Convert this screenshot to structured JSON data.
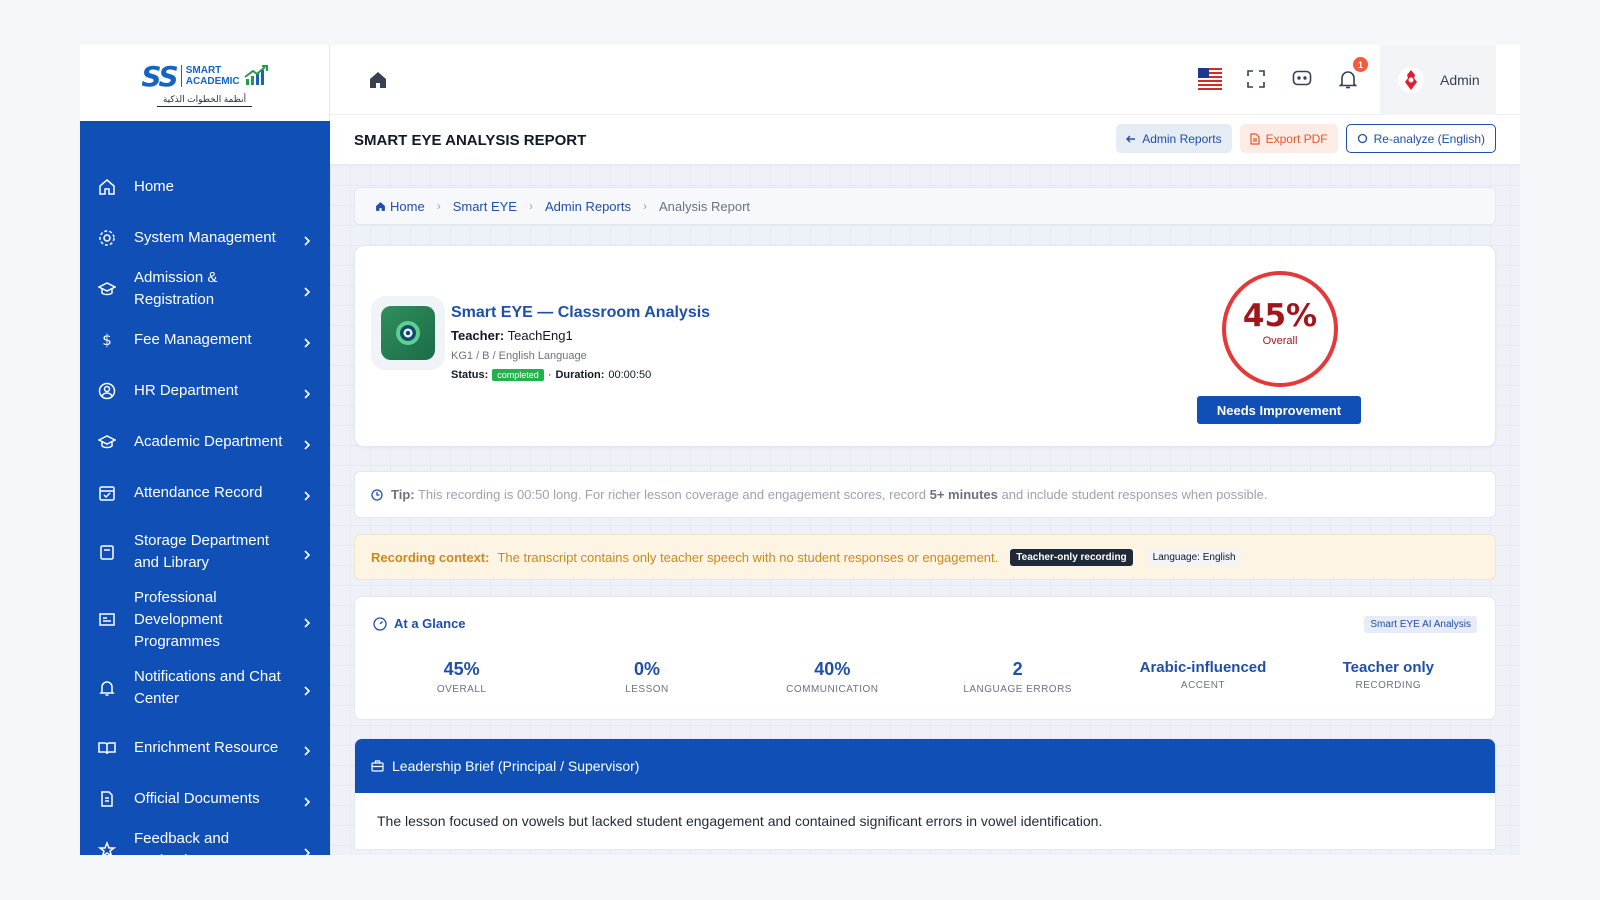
{
  "logo": {
    "mark": "SS",
    "line1": "SMART",
    "line2": "ACADEMIC",
    "arabic": "أنظمة الخطوات الذكية"
  },
  "sidebar": {
    "items": [
      {
        "label": "Home",
        "icon": "home-icon",
        "chevron": false
      },
      {
        "label": "System Management",
        "icon": "gear-icon",
        "chevron": true
      },
      {
        "label": "Admission & Registration",
        "icon": "graduation-cap-icon",
        "chevron": true
      },
      {
        "label": "Fee Management",
        "icon": "dollar-icon",
        "chevron": true
      },
      {
        "label": "HR Department",
        "icon": "user-circle-icon",
        "chevron": true
      },
      {
        "label": "Academic Department",
        "icon": "graduation-cap-icon",
        "chevron": true
      },
      {
        "label": "Attendance Record",
        "icon": "calendar-check-icon",
        "chevron": true
      },
      {
        "label": "Storage Department and Library",
        "icon": "archive-icon",
        "chevron": true
      },
      {
        "label": "Professional Development Programmes",
        "icon": "presentation-icon",
        "chevron": true
      },
      {
        "label": "Notifications and Chat Center",
        "icon": "bell-icon",
        "chevron": true
      },
      {
        "label": "Enrichment Resource",
        "icon": "book-open-icon",
        "chevron": true
      },
      {
        "label": "Official Documents",
        "icon": "document-icon",
        "chevron": true
      },
      {
        "label": "Feedback and Evaluation",
        "icon": "star-icon",
        "chevron": true
      }
    ]
  },
  "topbar": {
    "notification_count": "1",
    "user_name": "Admin"
  },
  "subheader": {
    "title": "SMART EYE ANALYSIS REPORT",
    "btn_admin_reports": "Admin Reports",
    "btn_export_pdf": "Export PDF",
    "btn_reanalyze": "Re-analyze (English)"
  },
  "breadcrumb": {
    "home": "Home",
    "smart_eye": "Smart EYE",
    "admin_reports": "Admin Reports",
    "current": "Analysis Report"
  },
  "hero": {
    "title": "Smart EYE — Classroom Analysis",
    "teacher_label": "Teacher:",
    "teacher_name": "TeachEng1",
    "meta": "KG1 / B / English Language",
    "status_label": "Status:",
    "status_value": "completed",
    "duration_label": "Duration:",
    "duration_value": "00:00:50",
    "score_value": "45%",
    "score_label": "Overall",
    "score_fraction": 0.45,
    "rating": "Needs Improvement"
  },
  "tip": {
    "label": "Tip:",
    "text_before": "This recording is 00:50 long. For richer lesson coverage and engagement scores, record",
    "emphasis": "5+ minutes",
    "text_after": "and include student responses when possible."
  },
  "context": {
    "label": "Recording context:",
    "text": "The transcript contains only teacher speech with no student responses or engagement.",
    "tag1": "Teacher-only recording",
    "tag2": "Language: English"
  },
  "glance": {
    "title": "At a Glance",
    "ai_tag": "Smart EYE AI Analysis",
    "metrics": [
      {
        "value": "45%",
        "label": "OVERALL"
      },
      {
        "value": "0%",
        "label": "LESSON"
      },
      {
        "value": "40%",
        "label": "COMMUNICATION"
      },
      {
        "value": "2",
        "label": "LANGUAGE ERRORS"
      },
      {
        "value": "Arabic-influenced",
        "label": "ACCENT"
      },
      {
        "value": "Teacher only",
        "label": "RECORDING"
      }
    ]
  },
  "brief": {
    "title": "Leadership Brief (Principal / Supervisor)",
    "text": "The lesson focused on vowels but lacked student engagement and contained significant errors in vowel identification."
  },
  "colors": {
    "primary": "#0f4fb6",
    "score_ring": "#e5383b",
    "completed": "#22b14c",
    "context_bg": "#fdf4e3"
  }
}
